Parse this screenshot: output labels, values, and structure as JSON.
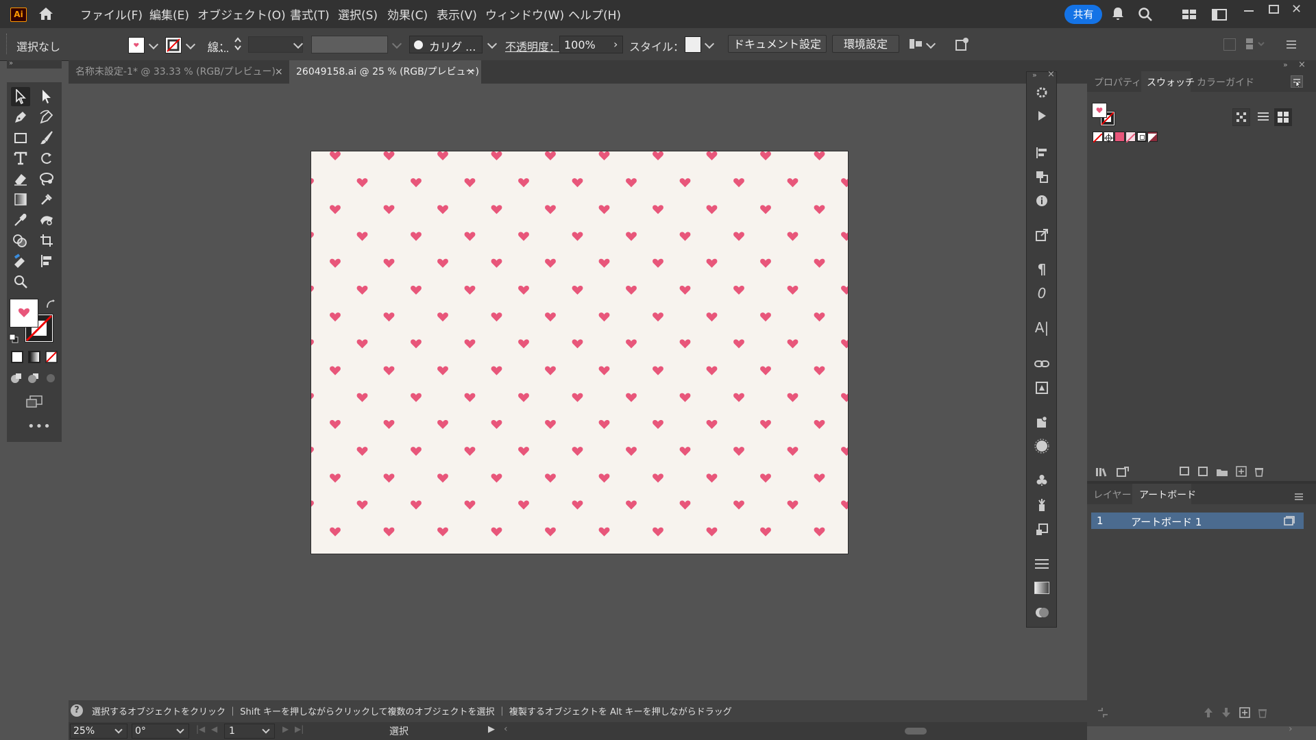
{
  "app": {
    "logo": "Ai"
  },
  "menu": [
    "ファイル(F)",
    "編集(E)",
    "オブジェクト(O)",
    "書式(T)",
    "選択(S)",
    "効果(C)",
    "表示(V)",
    "ウィンドウ(W)",
    "ヘルプ(H)"
  ],
  "header": {
    "share": "共有"
  },
  "control": {
    "selection": "選択なし",
    "stroke_label": "線：",
    "brush": "カリグ ...",
    "opacity_label": "不透明度：",
    "opacity_value": "100%",
    "style_label": "スタイル：",
    "doc_settings": "ドキュメント設定",
    "preferences": "環境設定"
  },
  "tabs": [
    {
      "label": "名称未設定-1* @ 33.33 % (RGB/プレビュー)",
      "close": "×"
    },
    {
      "label": "26049158.ai @ 25 % (RGB/プレビュー)",
      "close": "×"
    }
  ],
  "panel": {
    "tabs": [
      "プロパティ",
      "スウォッチ",
      "カラーガイド"
    ],
    "layers_tabs": [
      "レイヤー",
      "アートボード"
    ],
    "artboard_row": {
      "num": "1",
      "name": "アートボード 1"
    }
  },
  "status": {
    "hint": "選択するオブジェクトをクリック ｜ Shift キーを押しながらクリックして複数のオブジェクトを選択 ｜ 複製するオブジェクトを Alt キーを押しながらドラッグ",
    "zoom": "25%",
    "rotation": "0°",
    "artboard_num": "1",
    "tool": "選択"
  },
  "colors": {
    "heart": "#e8567a",
    "artboard_bg": "#f7f3ee",
    "accent": "#1473e6"
  },
  "icons": [
    "home-icon",
    "bell-icon",
    "search-icon",
    "arrange-documents-icon",
    "workspace-icon",
    "selection-tool-icon",
    "direct-selection-tool-icon",
    "pen-tool-icon",
    "curvature-tool-icon",
    "rectangle-tool-icon",
    "paintbrush-tool-icon",
    "type-tool-icon",
    "rotate-tool-icon",
    "eraser-tool-icon",
    "lasso-tool-icon",
    "gradient-tool-icon",
    "mesh-tool-icon",
    "eyedropper-tool-icon",
    "puppet-warp-icon",
    "shape-builder-icon",
    "artboard-tool-icon",
    "live-paint-icon",
    "align-icon",
    "zoom-tool-icon",
    "heart-icon"
  ]
}
